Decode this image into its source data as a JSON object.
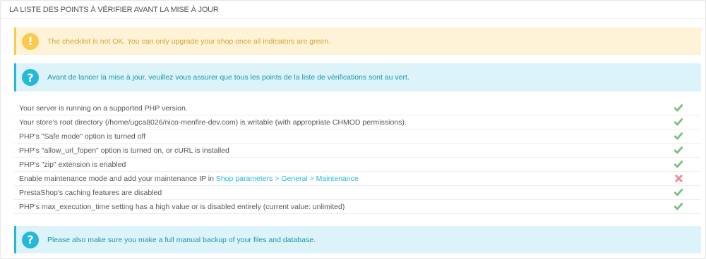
{
  "panel": {
    "title": "LA LISTE DES POINTS À VÉRIFIER AVANT LA MISE À JOUR"
  },
  "warning": {
    "icon": "exclamation-icon",
    "text": "The checklist is not OK. You can only upgrade your shop once all indicators are green."
  },
  "info_top": {
    "icon": "question-icon",
    "text": "Avant de lancer la mise à jour, veuillez vous assurer que tous les points de la liste de vérifications sont au vert."
  },
  "checklist": [
    {
      "text": "Your server is running on a supported PHP version.",
      "status": "ok"
    },
    {
      "text": "Your store's root directory (/home/ugca8026/nico-menfire-dev.com) is writable (with appropriate CHMOD permissions).",
      "status": "ok"
    },
    {
      "text": "PHP's \"Safe mode\" option is turned off",
      "status": "ok"
    },
    {
      "text": "PHP's \"allow_url_fopen\" option is turned on, or cURL is installed",
      "status": "ok"
    },
    {
      "text": "PHP's \"zip\" extension is enabled",
      "status": "ok"
    },
    {
      "text": "Enable maintenance mode and add your maintenance IP in ",
      "link": "Shop parameters > General > Maintenance",
      "status": "fail"
    },
    {
      "text": "PrestaShop's caching features are disabled",
      "status": "ok"
    },
    {
      "text": "PHP's max_execution_time setting has a high value or is disabled entirely (current value: unlimited)",
      "status": "ok"
    }
  ],
  "info_bottom": {
    "icon": "question-icon",
    "text": "Please also make sure you make a full manual backup of your files and database."
  },
  "colors": {
    "ok": "#72c279",
    "fail": "#e08f95",
    "info": "#25b9d7",
    "warning": "#fcc94f"
  }
}
